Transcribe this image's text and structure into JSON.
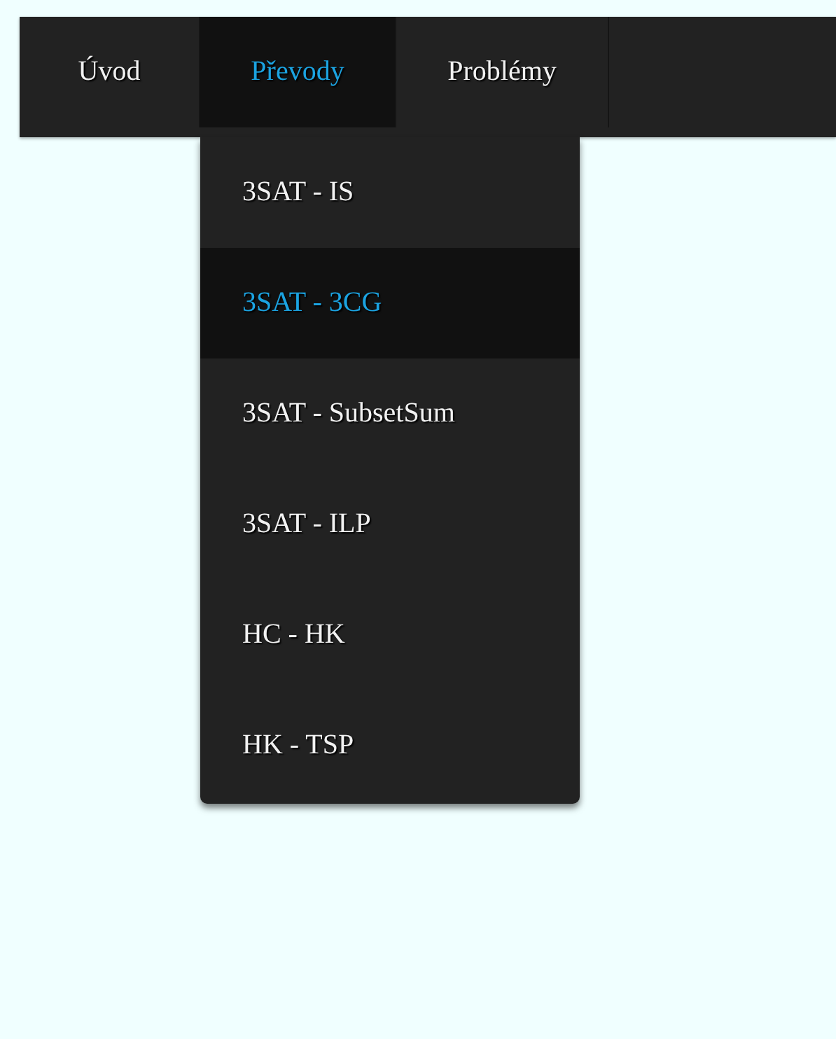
{
  "nav": [
    {
      "label": "Úvod",
      "selected": false
    },
    {
      "label": "Převody",
      "selected": true,
      "menu": [
        {
          "label": "3SAT - IS",
          "selected": false
        },
        {
          "label": "3SAT - 3CG",
          "selected": true
        },
        {
          "label": "3SAT - SubsetSum",
          "selected": false
        },
        {
          "label": "3SAT - ILP",
          "selected": false
        },
        {
          "label": "HC - HK",
          "selected": false
        },
        {
          "label": "HK - TSP",
          "selected": false
        }
      ]
    },
    {
      "label": "Problémy",
      "selected": false
    }
  ]
}
